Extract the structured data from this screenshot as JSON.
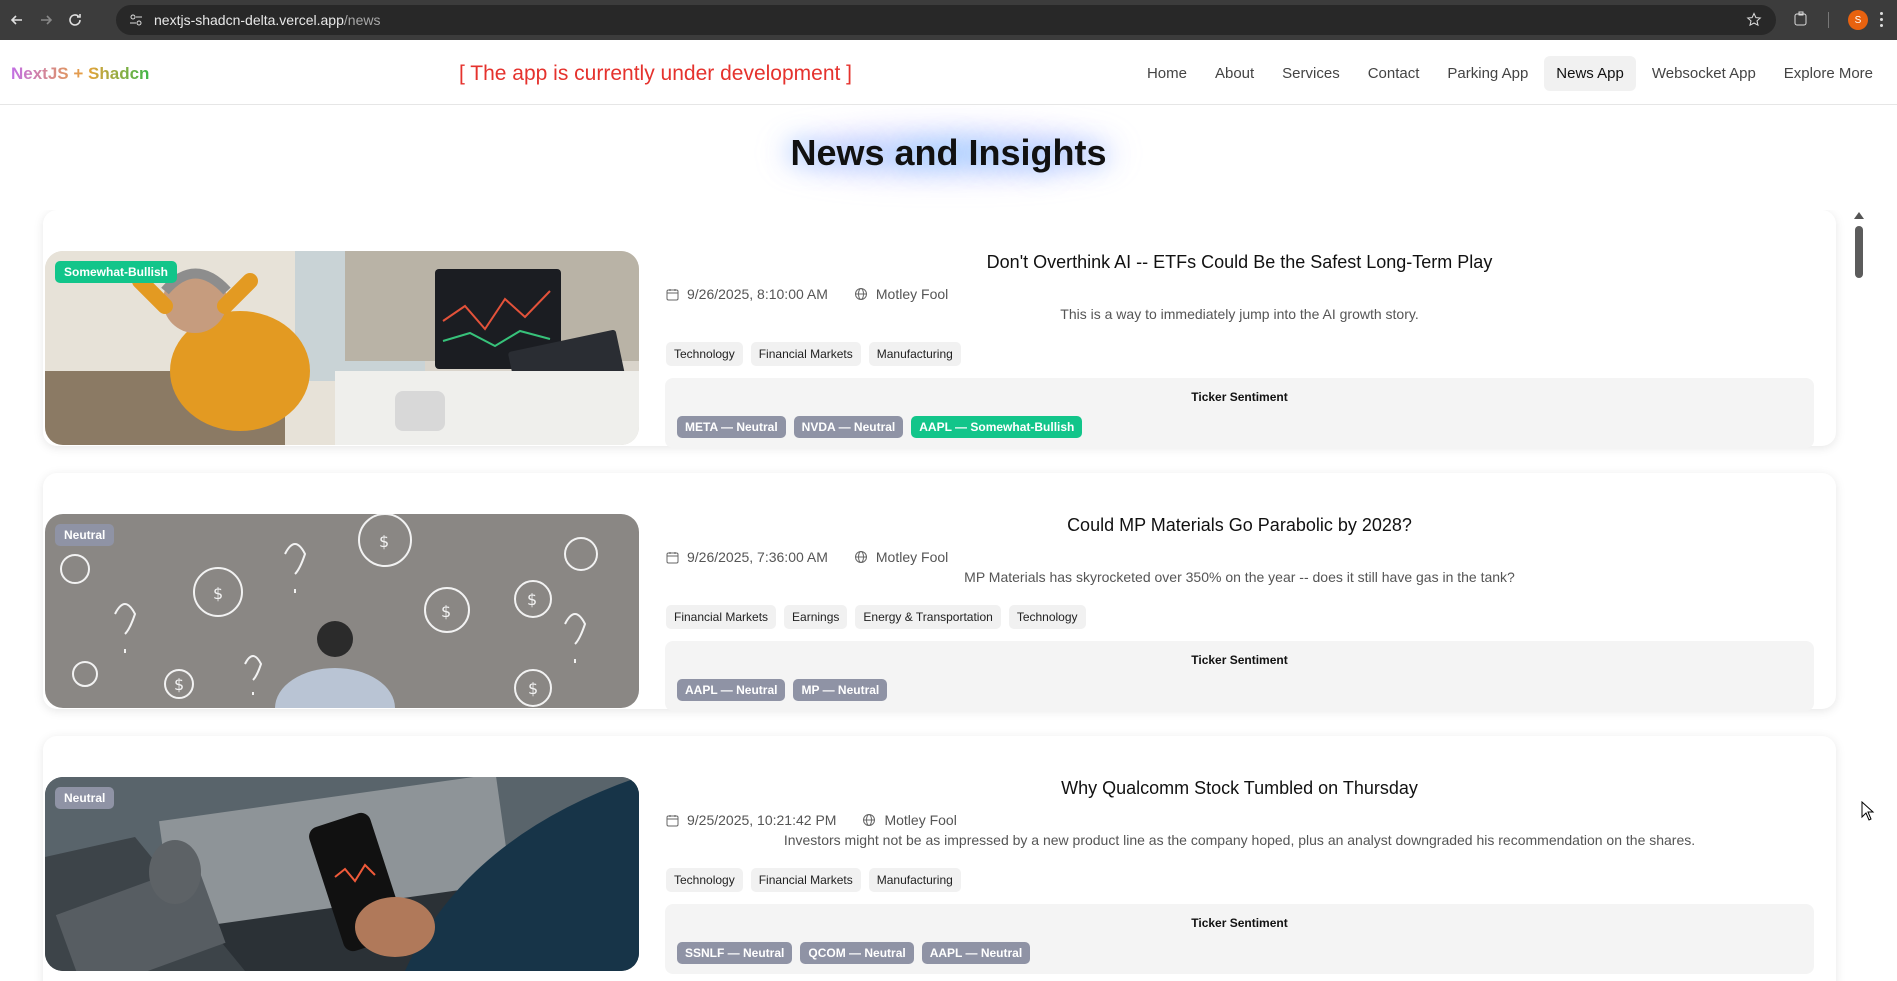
{
  "browser": {
    "url_host": "nextjs-shadcn-delta.vercel.app",
    "url_path": "/news",
    "profile_initial": "S"
  },
  "header": {
    "brand": "NextJS + Shadcn",
    "dev_banner": "[ The app is currently under development ]",
    "nav": [
      {
        "label": "Home"
      },
      {
        "label": "About"
      },
      {
        "label": "Services"
      },
      {
        "label": "Contact"
      },
      {
        "label": "Parking App"
      },
      {
        "label": "News App",
        "active": true
      },
      {
        "label": "Websocket App"
      },
      {
        "label": "Explore More"
      }
    ]
  },
  "page_title": "News and Insights",
  "ticker_heading": "Ticker Sentiment",
  "articles": [
    {
      "sentiment": "Somewhat-Bullish",
      "title": "Don't Overthink AI -- ETFs Could Be the Safest Long-Term Play",
      "date": "9/26/2025, 8:10:00 AM",
      "source": "Motley Fool",
      "summary": "This is a way to immediately jump into the AI growth story.",
      "tags": [
        "Technology",
        "Financial Markets",
        "Manufacturing"
      ],
      "tickers": [
        {
          "label": "META — Neutral",
          "sentiment": "Neutral"
        },
        {
          "label": "NVDA — Neutral",
          "sentiment": "Neutral"
        },
        {
          "label": "AAPL — Somewhat-Bullish",
          "sentiment": "Somewhat-Bullish"
        }
      ]
    },
    {
      "sentiment": "Neutral",
      "title": "Could MP Materials Go Parabolic by 2028?",
      "date": "9/26/2025, 7:36:00 AM",
      "source": "Motley Fool",
      "summary": "MP Materials has skyrocketed over 350% on the year -- does it still have gas in the tank?",
      "tags": [
        "Financial Markets",
        "Earnings",
        "Energy & Transportation",
        "Technology"
      ],
      "tickers": [
        {
          "label": "AAPL — Neutral",
          "sentiment": "Neutral"
        },
        {
          "label": "MP — Neutral",
          "sentiment": "Neutral"
        }
      ]
    },
    {
      "sentiment": "Neutral",
      "title": "Why Qualcomm Stock Tumbled on Thursday",
      "date": "9/25/2025, 10:21:42 PM",
      "source": "Motley Fool",
      "summary": "Investors might not be as impressed by a new product line as the company hoped, plus an analyst downgraded his recommendation on the shares.",
      "tags": [
        "Technology",
        "Financial Markets",
        "Manufacturing"
      ],
      "tickers": [
        {
          "label": "SSNLF — Neutral",
          "sentiment": "Neutral"
        },
        {
          "label": "QCOM — Neutral",
          "sentiment": "Neutral"
        },
        {
          "label": "AAPL — Neutral",
          "sentiment": "Neutral"
        }
      ]
    }
  ],
  "colors": {
    "bullish": "#12c58a",
    "neutral": "#8f93a5",
    "dev_banner": "#e5322d"
  }
}
